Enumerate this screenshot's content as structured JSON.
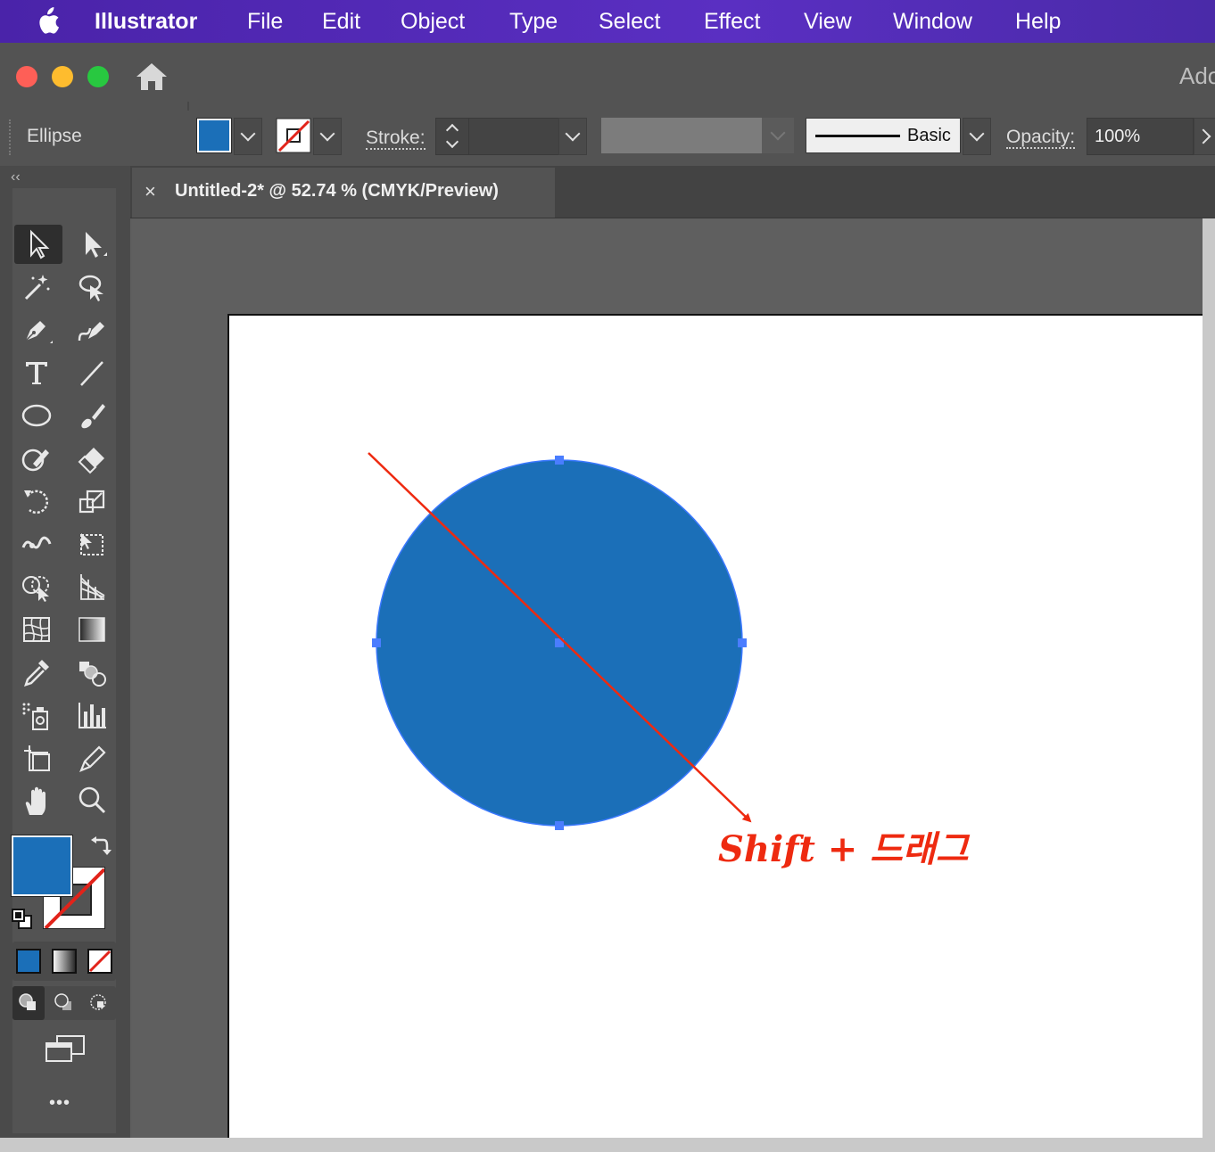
{
  "menubar": {
    "app_name": "Illustrator",
    "items": [
      "File",
      "Edit",
      "Object",
      "Type",
      "Select",
      "Effect",
      "View",
      "Window",
      "Help"
    ]
  },
  "titlebar": {
    "right_text": "Ado"
  },
  "control_bar": {
    "tool_name": "Ellipse",
    "fill_color": "#1b6fb8",
    "stroke_label": "Stroke:",
    "brush_label": "Basic",
    "opacity_label": "Opacity:",
    "opacity_value": "100%"
  },
  "document_tab": {
    "close_icon": "×",
    "title": "Untitled-2* @ 52.74 % (CMYK/Preview)"
  },
  "toolbar": {
    "collapse_icon": "‹‹",
    "more_icon": "•••",
    "fill_color": "#1b6fb8"
  },
  "canvas": {
    "shape_fill": "#1b6fb8",
    "annotation_color": "#ee2a10",
    "annotation_text": "Shift + 드래그"
  }
}
